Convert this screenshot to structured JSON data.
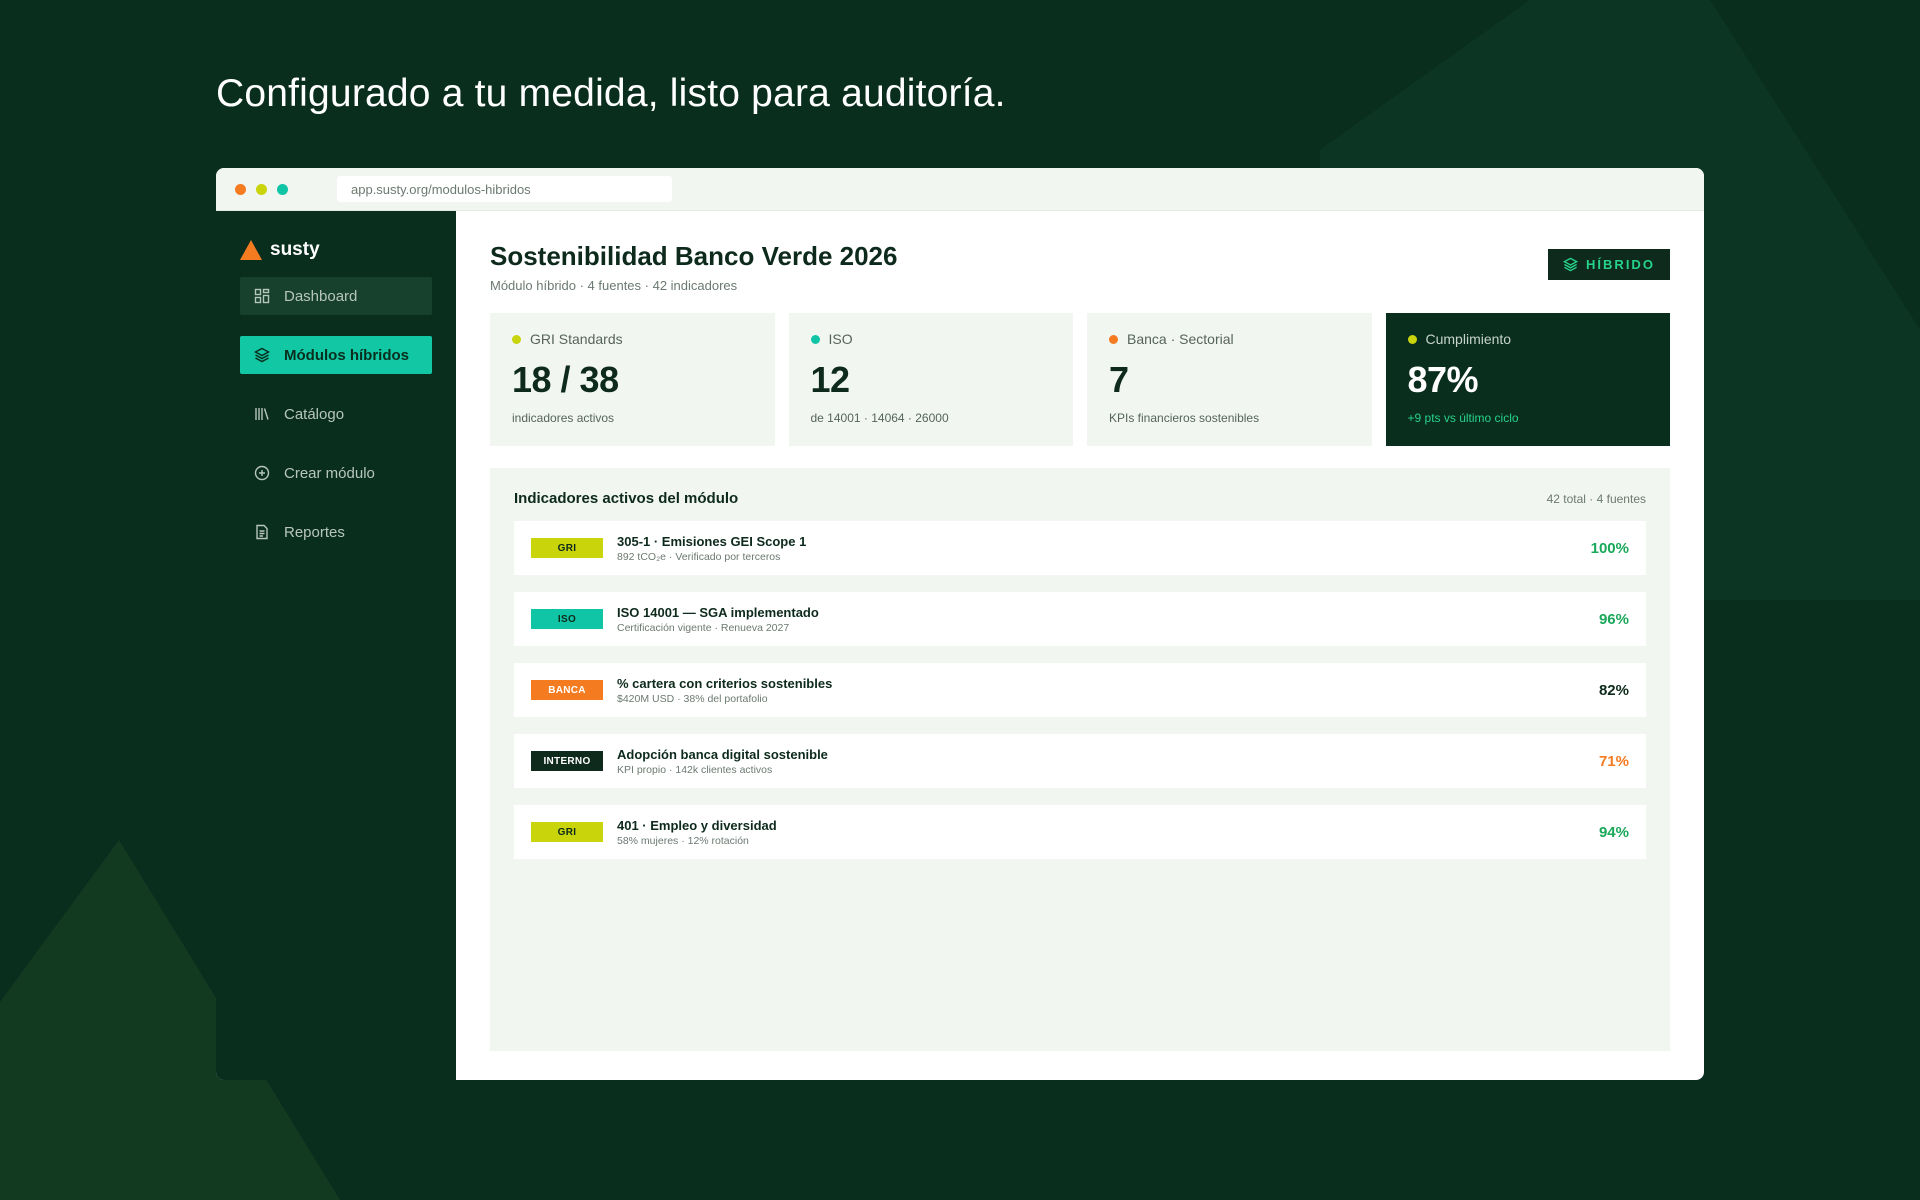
{
  "headline": "Configurado a tu medida, listo para auditoría.",
  "browser": {
    "url": "app.susty.org/modulos-hibridos"
  },
  "brand": {
    "name": "susty",
    "color": "#f47b20"
  },
  "sidebar": {
    "items": [
      {
        "label": "Dashboard",
        "icon": "grid-icon"
      },
      {
        "label": "Módulos híbridos",
        "icon": "layers-icon"
      },
      {
        "label": "Catálogo",
        "icon": "library-icon"
      },
      {
        "label": "Crear módulo",
        "icon": "plus-circle-icon"
      },
      {
        "label": "Reportes",
        "icon": "document-icon"
      }
    ]
  },
  "page": {
    "title": "Sostenibilidad Banco Verde 2026",
    "subtitle": "Módulo híbrido · 4 fuentes · 42 indicadores",
    "badge": "HÍBRIDO"
  },
  "cards": [
    {
      "label": "GRI Standards",
      "value": "18 / 38",
      "note": "indicadores activos",
      "color": "#c9d40a"
    },
    {
      "label": "ISO",
      "value": "12",
      "note": "de 14001 · 14064 · 26000",
      "color": "#10c4a6"
    },
    {
      "label": "Banca · Sectorial",
      "value": "7",
      "note": "KPIs financieros sostenibles",
      "color": "#f47b20"
    },
    {
      "label": "Cumplimiento",
      "value": "87%",
      "note": "+9 pts vs último ciclo",
      "color": "#c9d40a"
    }
  ],
  "panel": {
    "title": "Indicadores activos del módulo",
    "meta": "42 total · 4 fuentes",
    "rows": [
      {
        "tag": "GRI",
        "title": "305-1 · Emisiones GEI Scope 1",
        "sub": "892 tCO₂e · Verificado por terceros",
        "pct": "100%",
        "tag_bg": "#c9d40a",
        "tag_fg": "#0d2a1c",
        "pct_color": "#1aa85a"
      },
      {
        "tag": "ISO",
        "title": "ISO 14001 — SGA implementado",
        "sub": "Certificación vigente · Renueva 2027",
        "pct": "96%",
        "tag_bg": "#10c4a6",
        "tag_fg": "#0d2a1c",
        "pct_color": "#1aa85a"
      },
      {
        "tag": "BANCA",
        "title": "% cartera con criterios sostenibles",
        "sub": "$420M USD · 38% del portafolio",
        "pct": "82%",
        "tag_bg": "#f47b20",
        "tag_fg": "#ffffff",
        "pct_color": "#0d2a1c"
      },
      {
        "tag": "INTERNO",
        "title": "Adopción banca digital sostenible",
        "sub": "KPI propio · 142k clientes activos",
        "pct": "71%",
        "tag_bg": "#0d2a1c",
        "tag_fg": "#ffffff",
        "pct_color": "#f47b20"
      },
      {
        "tag": "GRI",
        "title": "401 · Empleo y diversidad",
        "sub": "58% mujeres · 12% rotación",
        "pct": "94%",
        "tag_bg": "#c9d40a",
        "tag_fg": "#0d2a1c",
        "pct_color": "#1aa85a"
      }
    ]
  },
  "colors": {
    "bg": "#0a2e1e",
    "accent": "#12c7a4",
    "success": "#27d28a"
  }
}
